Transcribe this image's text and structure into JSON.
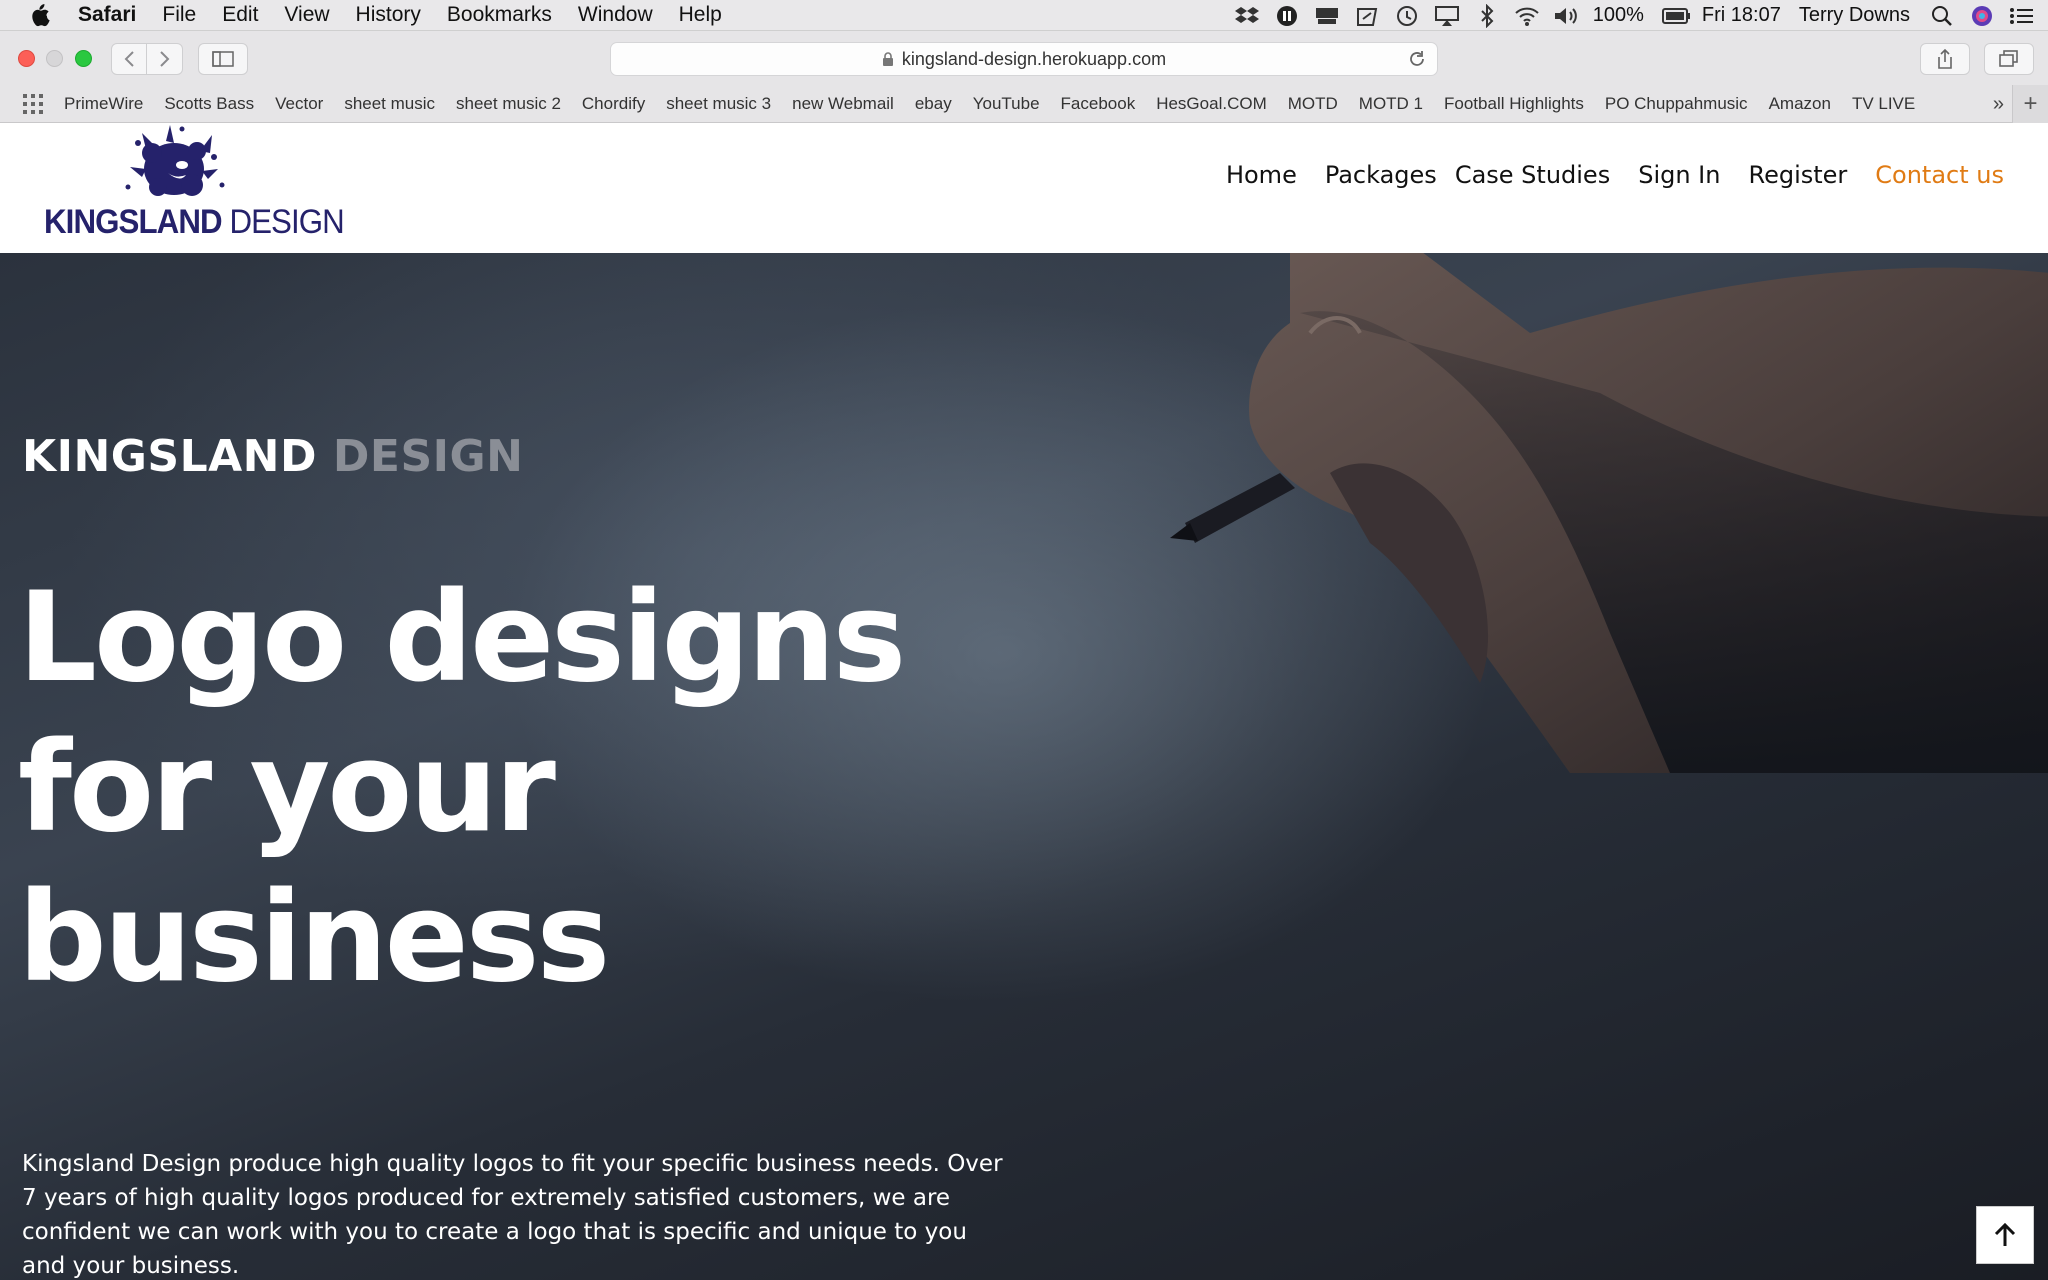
{
  "menubar": {
    "app": "Safari",
    "items": [
      "File",
      "Edit",
      "View",
      "History",
      "Bookmarks",
      "Window",
      "Help"
    ],
    "battery": "100%",
    "clock": "Fri 18:07",
    "user": "Terry Downs"
  },
  "toolbar": {
    "url": "kingsland-design.herokuapp.com"
  },
  "bookmarks": [
    "PrimeWire",
    "Scotts Bass",
    "Vector",
    "sheet music",
    "sheet music 2",
    "Chordify",
    "sheet music 3",
    "new Webmail",
    "ebay",
    "YouTube",
    "Facebook",
    "HesGoal.COM",
    "MOTD",
    "MOTD 1",
    "Football Highlights",
    "PO Chuppahmusic",
    "Amazon",
    "TV LIVE"
  ],
  "site": {
    "logo": {
      "word1": "KINGSLAND",
      "word2": "DESIGN"
    },
    "nav": [
      "Home",
      "Packages",
      "Case Studies",
      "Sign In",
      "Register",
      "Contact us"
    ],
    "accent": "#e07b14",
    "brand_color": "#25226b"
  },
  "hero": {
    "brand_primary": "KINGSLAND",
    "brand_secondary": "DESIGN",
    "title_lines": [
      "Logo designs",
      "for your",
      "business"
    ],
    "description": "Kingsland Design produce high quality logos to fit your specific business needs. Over 7 years of high quality logos produced for extremely satisfied customers, we are confident we can work with you to create a logo that is specific and unique to you and your business."
  }
}
